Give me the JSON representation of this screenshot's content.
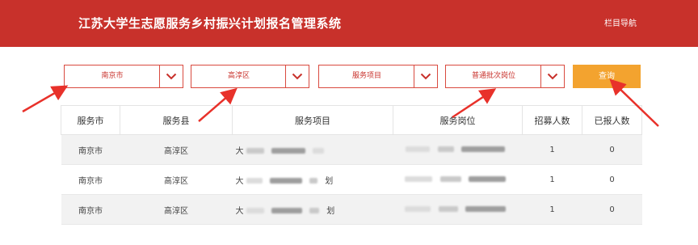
{
  "header": {
    "title": "江苏大学生志愿服务乡村振兴计划报名管理系统",
    "nav_label": "栏目导航"
  },
  "filters": {
    "city": "南京市",
    "county": "高淳区",
    "project": "服务项目",
    "post": "普通批次岗位",
    "query_label": "查询"
  },
  "table": {
    "columns": [
      "服务市",
      "服务县",
      "服务项目",
      "服务岗位",
      "招募人数",
      "已报人数"
    ],
    "rows": [
      {
        "city": "南京市",
        "county": "高淳区",
        "project_prefix": "大",
        "project_suffix": "",
        "recruit": "1",
        "applied": "0"
      },
      {
        "city": "南京市",
        "county": "高淳区",
        "project_prefix": "大",
        "project_suffix": "划",
        "recruit": "1",
        "applied": "0"
      },
      {
        "city": "南京市",
        "county": "高淳区",
        "project_prefix": "大",
        "project_suffix": "划",
        "recruit": "1",
        "applied": "0"
      }
    ]
  },
  "colors": {
    "header_bg": "#c8312b",
    "accent_border": "#d94a3f",
    "query_bg": "#f3a32f",
    "arrow": "#e8312a"
  }
}
